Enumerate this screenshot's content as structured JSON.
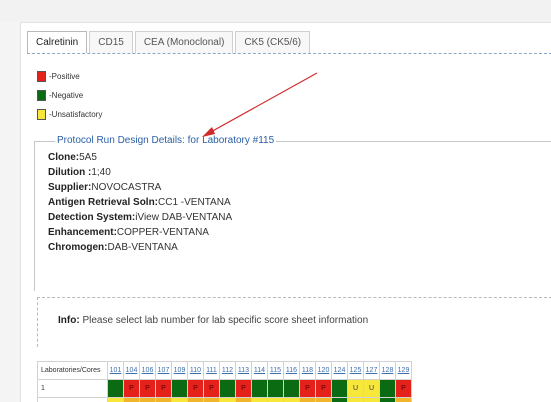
{
  "tabs": [
    {
      "label": "Calretinin",
      "active": true
    },
    {
      "label": "CD15",
      "active": false
    },
    {
      "label": "CEA (Monoclonal)",
      "active": false
    },
    {
      "label": "CK5 (CK5/6)",
      "active": false
    }
  ],
  "legend": [
    {
      "label": "-Positive",
      "color": "#e5211c"
    },
    {
      "label": "-Negative",
      "color": "#0a6b12"
    },
    {
      "label": "-Unsatisfactory",
      "color": "#f7e73b"
    }
  ],
  "protocol": {
    "title": "Protocol Run Design Details: for Laboratory #115",
    "fields": [
      {
        "key": "Clone:",
        "value": "5A5"
      },
      {
        "key": "Dilution :",
        "value": "1;40"
      },
      {
        "key": "Supplier:",
        "value": "NOVOCASTRA"
      },
      {
        "key": "Antigen Retrieval Soln:",
        "value": "CC1 -VENTANA"
      },
      {
        "key": "Detection System:",
        "value": "iView DAB-VENTANA"
      },
      {
        "key": "Enhancement:",
        "value": "COPPER-VENTANA"
      },
      {
        "key": "Chromogen:",
        "value": "DAB-VENTANA"
      }
    ]
  },
  "info": {
    "label": "Info:",
    "text": "Please select lab number for lab specific score sheet information"
  },
  "scoregrid": {
    "header_label": "Laboratories/Cores",
    "labs": [
      "101",
      "104",
      "106",
      "107",
      "109",
      "110",
      "111",
      "112",
      "113",
      "114",
      "115",
      "116",
      "118",
      "120",
      "124",
      "125",
      "127",
      "128",
      "129"
    ],
    "rows": [
      {
        "core": "1",
        "cells": [
          "N",
          "P",
          "P",
          "P",
          "N",
          "P",
          "P",
          "N",
          "P",
          "N",
          "N",
          "N",
          "P",
          "P",
          "N",
          "U",
          "U",
          "N",
          "P"
        ]
      }
    ]
  },
  "colors": {
    "accent": "#2a5fa5",
    "arrow": "#d02a2a"
  }
}
